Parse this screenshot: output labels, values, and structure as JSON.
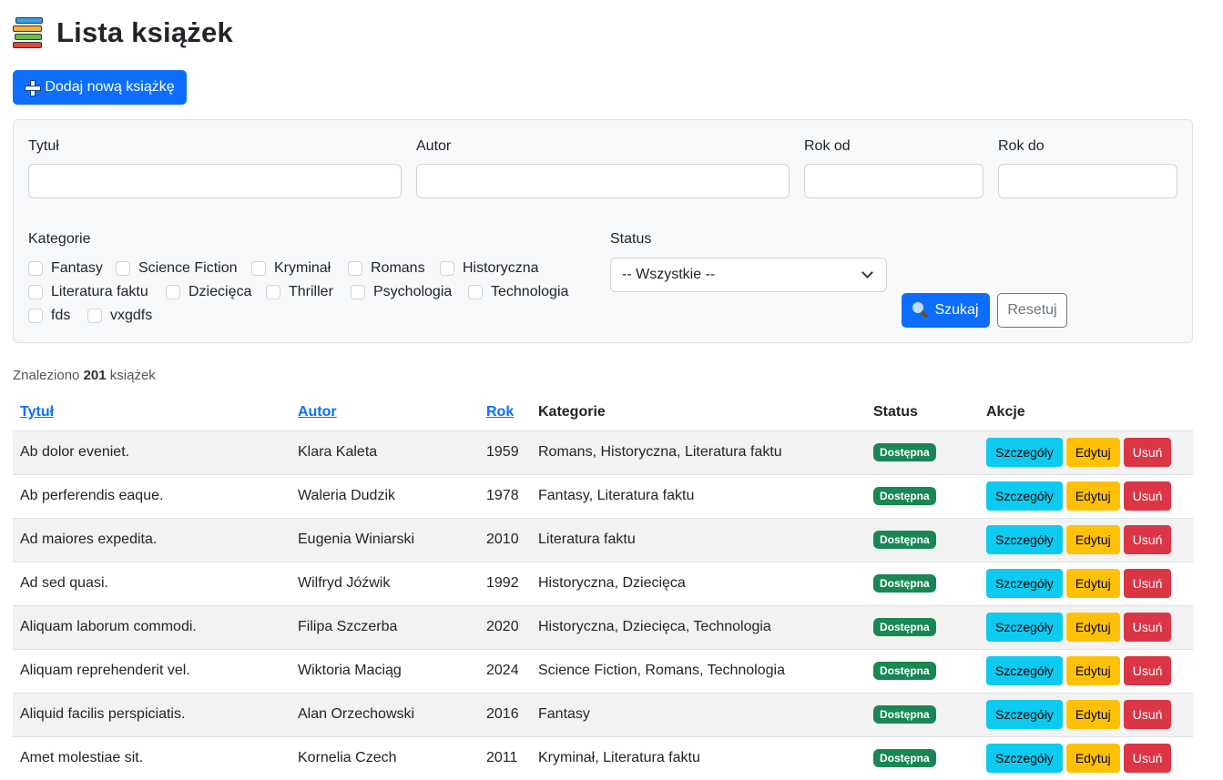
{
  "header": {
    "title": "Lista książek",
    "icon": "books-icon"
  },
  "add_button": {
    "label": "Dodaj nową książkę",
    "icon": "plus-icon"
  },
  "filters": {
    "title_label": "Tytuł",
    "title_value": "",
    "author_label": "Autor",
    "author_value": "",
    "year_from_label": "Rok od",
    "year_from_value": "",
    "year_to_label": "Rok do",
    "year_to_value": "",
    "categories_label": "Kategorie",
    "categories": [
      "Fantasy",
      "Science Fiction",
      "Kryminał",
      "Romans",
      "Historyczna",
      "Literatura faktu",
      "Dziecięca",
      "Thriller",
      "Psychologia",
      "Technologia",
      "fds",
      "vxgdfs"
    ],
    "status_label": "Status",
    "status_selected": "-- Wszystkie --",
    "search_label": "Szukaj",
    "reset_label": "Resetuj"
  },
  "results": {
    "prefix": "Znaleziono",
    "count": "201",
    "suffix": "książek"
  },
  "table": {
    "headers": {
      "title": "Tytuł",
      "author": "Autor",
      "year": "Rok",
      "categories": "Kategorie",
      "status": "Status",
      "actions": "Akcje"
    },
    "action_labels": {
      "details": "Szczegóły",
      "edit": "Edytuj",
      "delete": "Usuń"
    },
    "rows": [
      {
        "title": "Ab dolor eveniet.",
        "author": "Klara Kaleta",
        "year": "1959",
        "categories": "Romans, Historyczna, Literatura faktu",
        "status": "Dostępna"
      },
      {
        "title": "Ab perferendis eaque.",
        "author": "Waleria Dudzik",
        "year": "1978",
        "categories": "Fantasy, Literatura faktu",
        "status": "Dostępna"
      },
      {
        "title": "Ad maiores expedita.",
        "author": "Eugenia Winiarski",
        "year": "2010",
        "categories": "Literatura faktu",
        "status": "Dostępna"
      },
      {
        "title": "Ad sed quasi.",
        "author": "Wilfryd Jóźwik",
        "year": "1992",
        "categories": "Historyczna, Dziecięca",
        "status": "Dostępna"
      },
      {
        "title": "Aliquam laborum commodi.",
        "author": "Filipa Szczerba",
        "year": "2020",
        "categories": "Historyczna, Dziecięca, Technologia",
        "status": "Dostępna"
      },
      {
        "title": "Aliquam reprehenderit vel.",
        "author": "Wiktoria Maciąg",
        "year": "2024",
        "categories": "Science Fiction, Romans, Technologia",
        "status": "Dostępna"
      },
      {
        "title": "Aliquid facilis perspiciatis.",
        "author": "Alan Orzechowski",
        "year": "2016",
        "categories": "Fantasy",
        "status": "Dostępna"
      },
      {
        "title": "Amet molestiae sit.",
        "author": "Kornelia Czech",
        "year": "2011",
        "categories": "Kryminał, Literatura faktu",
        "status": "Dostępna"
      }
    ]
  },
  "colors": {
    "primary": "#0d6efd",
    "success": "#198754",
    "info": "#0dcaf0",
    "warning": "#ffc107",
    "danger": "#dc3545"
  }
}
